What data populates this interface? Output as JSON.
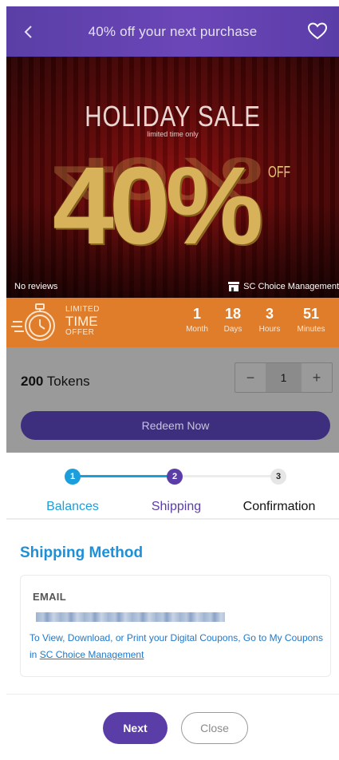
{
  "header": {
    "title": "40% off your next purchase",
    "back_icon": "chevron-left-icon",
    "favorite_icon": "heart-outline-icon"
  },
  "banner": {
    "headline": "HOLIDAY SALE",
    "subline": "limited time only",
    "big_text": "40%",
    "off_text": "OFF",
    "reviews": "No reviews",
    "merchant": "SC Choice Management"
  },
  "countdown": {
    "badge_line1": "LIMITED",
    "badge_line2": "TIME",
    "badge_line3": "OFFER",
    "units": [
      {
        "value": "1",
        "label": "Month"
      },
      {
        "value": "18",
        "label": "Days"
      },
      {
        "value": "3",
        "label": "Hours"
      },
      {
        "value": "51",
        "label": "Minutes"
      }
    ]
  },
  "product": {
    "tokens_amount": "200",
    "tokens_label": "Tokens",
    "quantity": "1",
    "minus": "−",
    "plus": "+",
    "redeem_label": "Redeem Now"
  },
  "steps": [
    {
      "number": "1",
      "label": "Balances"
    },
    {
      "number": "2",
      "label": "Shipping"
    },
    {
      "number": "3",
      "label": "Confirmation"
    }
  ],
  "shipping": {
    "title": "Shipping Method",
    "method_label": "EMAIL",
    "note_text": "To View, Download, or Print your Digital Coupons, Go to My Coupons in",
    "note_link": "SC Choice Management"
  },
  "footer": {
    "next_label": "Next",
    "close_label": "Close"
  },
  "colors": {
    "header_purple": "#6b46b8",
    "countdown_orange": "#e07d2a",
    "step_blue": "#1a9fdc",
    "step_purple": "#5b3da8",
    "link_blue": "#1f78c8"
  }
}
